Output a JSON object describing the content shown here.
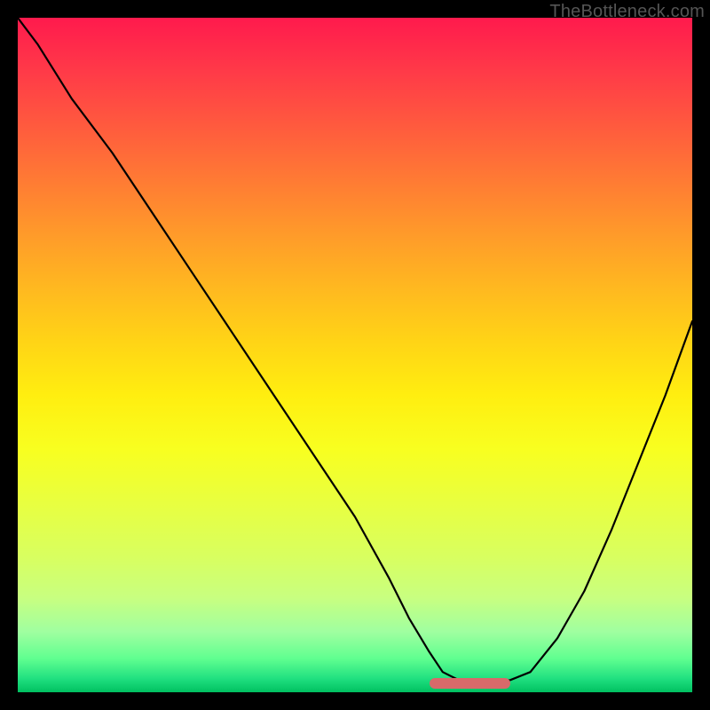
{
  "watermark": "TheBottleneck.com",
  "chart_data": {
    "type": "line",
    "title": "",
    "xlabel": "",
    "ylabel": "",
    "xlim": [
      0,
      100
    ],
    "ylim": [
      0,
      100
    ],
    "grid": false,
    "legend": false,
    "series": [
      {
        "name": "bottleneck-curve",
        "x": [
          0,
          3,
          8,
          14,
          20,
          26,
          32,
          38,
          44,
          50,
          55,
          58,
          61,
          63,
          66,
          70,
          73,
          76,
          80,
          84,
          88,
          92,
          96,
          100
        ],
        "values": [
          100,
          96,
          88,
          80,
          71,
          62,
          53,
          44,
          35,
          26,
          17,
          11,
          6,
          3,
          1.5,
          1.5,
          1.8,
          3,
          8,
          15,
          24,
          34,
          44,
          55
        ]
      }
    ],
    "optimum_band": {
      "x_start": 61,
      "x_end": 73,
      "y": 1.3
    },
    "colors": {
      "curve": "#000000",
      "marker": "#d86a6a",
      "gradient_top": "#ff1a4d",
      "gradient_bottom": "#00c060"
    }
  }
}
